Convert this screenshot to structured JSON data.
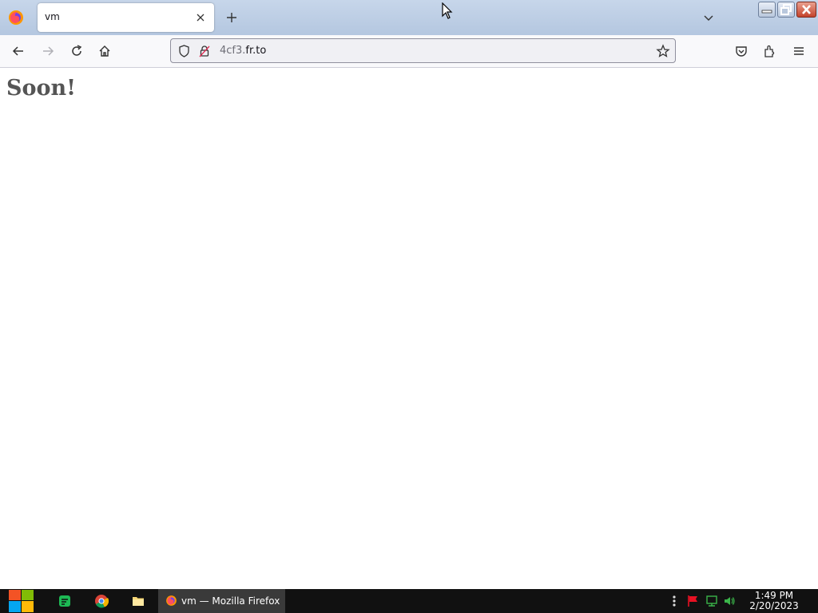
{
  "browser": {
    "tab": {
      "title": "vm"
    },
    "url": {
      "prefix": "4cf3.",
      "domain": "fr.to"
    }
  },
  "page": {
    "heading": "Soon!"
  },
  "taskbar": {
    "active_task_label": "vm — Mozilla Firefox",
    "clock": {
      "time": "1:49 PM",
      "date": "2/20/2023"
    }
  },
  "colors": {
    "tabstrip": "#b4c7e0",
    "taskbar": "#111111",
    "heading": "#555555"
  }
}
